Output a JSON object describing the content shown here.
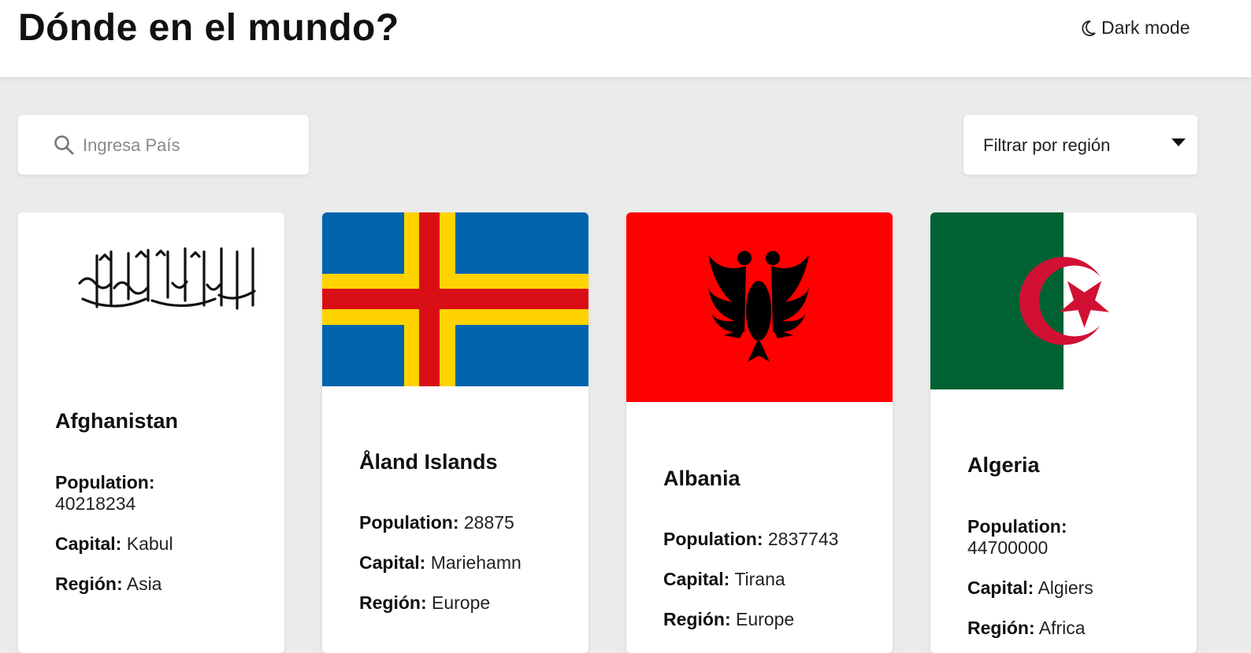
{
  "header": {
    "title": "Dónde en el mundo?",
    "dark_mode_label": "Dark mode"
  },
  "search": {
    "placeholder": "Ingresa País"
  },
  "filter": {
    "label": "Filtrar por región"
  },
  "labels": {
    "population": "Population:",
    "capital": "Capital:",
    "region": "Región:"
  },
  "countries": [
    {
      "name": "Afghanistan",
      "population": "40218234",
      "capital": "Kabul",
      "region": "Asia"
    },
    {
      "name": "Åland Islands",
      "population": "28875",
      "capital": "Mariehamn",
      "region": "Europe"
    },
    {
      "name": "Albania",
      "population": "2837743",
      "capital": "Tirana",
      "region": "Europe"
    },
    {
      "name": "Algeria",
      "population": "44700000",
      "capital": "Algiers",
      "region": "Africa"
    }
  ],
  "colors": {
    "background": "#ebebeb",
    "card": "#ffffff",
    "aland_blue": "#0064AD",
    "aland_yellow": "#FFD300",
    "aland_red": "#DA0E15",
    "albania_red": "#FF0000",
    "algeria_green": "#006233",
    "algeria_red": "#D21034"
  }
}
